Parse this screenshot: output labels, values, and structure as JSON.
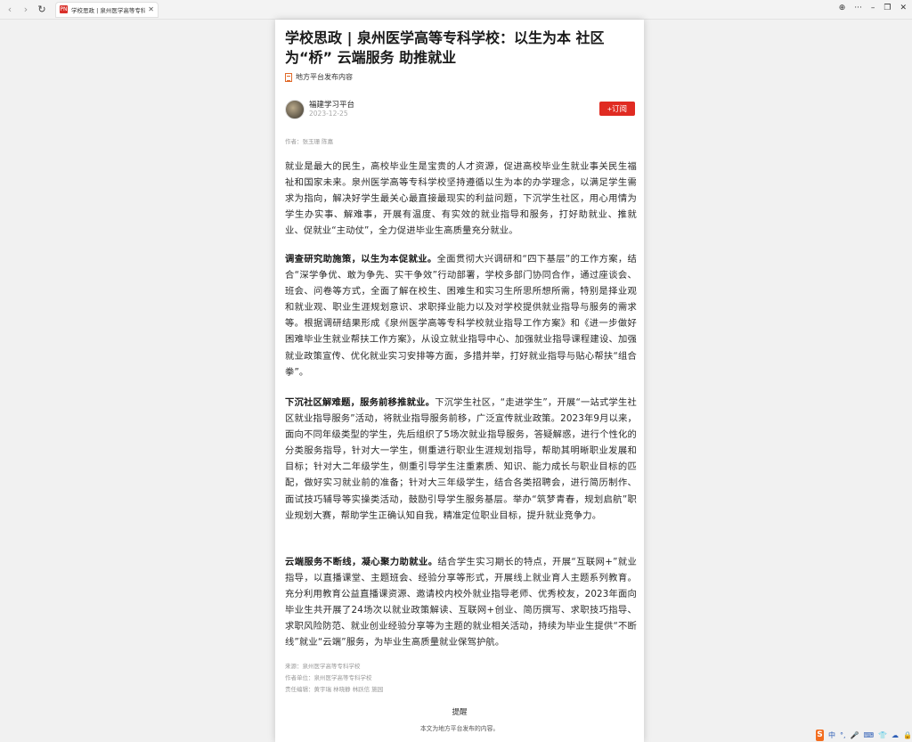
{
  "browser": {
    "tab_title": "学校思政 | 泉州医学高等专科学校",
    "favicon_text": "PN",
    "tab_close": "✕",
    "back": "‹",
    "forward": "›",
    "refresh": "↻",
    "win_controls": [
      "⊕",
      "···",
      "–",
      "❐",
      "✕"
    ]
  },
  "article": {
    "title": "学校思政 | 泉州医学高等专科学校：以生为本 社区为“桥” 云端服务 助推就业",
    "source_tag": "地方平台发布内容",
    "publisher_name": "福建学习平台",
    "publish_date": "2023-12-25",
    "subscribe_label": "+订阅",
    "author_line": "作者：张玉珊 陈嘉",
    "paragraphs": [
      {
        "lead": "",
        "text": "就业是最大的民生，高校毕业生是宝贵的人才资源，促进高校毕业生就业事关民生福祉和国家未来。泉州医学高等专科学校坚持遵循以生为本的办学理念，以满足学生需求为指向，解决好学生最关心最直接最现实的利益问题，下沉学生社区，用心用情为学生办实事、解难事，开展有温度、有实效的就业指导和服务，打好助就业、推就业、促就业“主动仗”，全力促进毕业生高质量充分就业。"
      },
      {
        "lead": "调查研究助施策，以生为本促就业。",
        "text": "全面贯彻大兴调研和“四下基层”的工作方案，结合“深学争优、敢为争先、实干争效”行动部署，学校多部门协同合作，通过座谈会、班会、问卷等方式，全面了解在校生、困难生和实习生所思所想所需，特别是择业观和就业观、职业生涯规划意识、求职择业能力以及对学校提供就业指导与服务的需求等。根据调研结果形成《泉州医学高等专科学校就业指导工作方案》和《进一步做好困难毕业生就业帮扶工作方案》，从设立就业指导中心、加强就业指导课程建设、加强就业政策宣传、优化就业实习安排等方面，多措并举，打好就业指导与贴心帮扶“组合拳”。"
      },
      {
        "lead": "下沉社区解难题，服务前移推就业。",
        "text": "下沉学生社区，“走进学生”，开展“一站式学生社区就业指导服务”活动，将就业指导服务前移，广泛宣传就业政策。2023年9月以来，面向不同年级类型的学生，先后组织了5场次就业指导服务，答疑解惑，进行个性化的分类服务指导，针对大一学生，侧重进行职业生涯规划指导，帮助其明晰职业发展和目标；针对大二年级学生，侧重引导学生注重素质、知识、能力成长与职业目标的匹配，做好实习就业前的准备；针对大三年级学生，结合各类招聘会，进行简历制作、面试技巧辅导等实操类活动，鼓励引导学生服务基层。举办“筑梦青春，规划启航”职业规划大赛，帮助学生正确认知自我，精准定位职业目标，提升就业竞争力。"
      },
      {
        "lead": "云端服务不断线，凝心聚力助就业。",
        "text": "结合学生实习期长的特点，开展“互联网+”就业指导，以直播课堂、主题班会、经验分享等形式，开展线上就业育人主题系列教育。充分利用教育公益直播课资源、邀请校内校外就业指导老师、优秀校友，2023年面向毕业生共开展了24场次以就业政策解读、互联网+创业、简历撰写、求职技巧指导、求职风险防范、就业创业经验分享等为主题的就业相关活动，持续为毕业生提供“不断线”就业“云端”服务，为毕业生高质量就业保驾护航。"
      }
    ],
    "meta_source": "来源：泉州医学高等专科学校",
    "meta_unit": "作者单位：泉州医学高等专科学校",
    "meta_editor": "责任编辑：黄宇瑞 林晓静 林跃信 施园",
    "notice_title": "提醒",
    "notice_text": "本文为地方平台发布的内容。"
  },
  "tray": {
    "ime_logo": "S",
    "items": [
      "中",
      "°,",
      "🎤",
      "⌨",
      "👕",
      "☁",
      "🔒"
    ]
  }
}
